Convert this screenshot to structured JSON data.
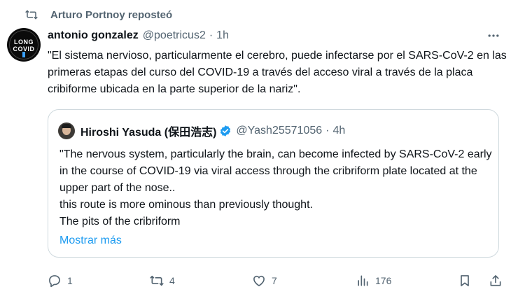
{
  "repost": {
    "text": "Arturo Portnoy reposteó"
  },
  "tweet": {
    "author_name": "antonio gonzalez",
    "author_handle": "@poetricus2",
    "separator": "·",
    "time": "1h",
    "avatar_text_top": "LONG",
    "avatar_text_bottom": "COVID",
    "text": "\"El sistema nervioso, particularmente el cerebro, puede infectarse por el SARS-CoV-2 en las primeras etapas del curso del COVID-19 a través del acceso viral a través de la placa cribiforme ubicada en la parte superior de la nariz\"."
  },
  "quote": {
    "author_name": "Hiroshi Yasuda (保田浩志)",
    "author_handle": "@Yash25571056",
    "separator": "·",
    "time": "4h",
    "text": "\"The nervous system, particularly the brain, can become infected by SARS-CoV-2 early in the course of COVID-19 via viral access through the cribriform plate located at the upper part of the nose..\nthis route is more ominous than previously thought.\nThe pits of the cribriform",
    "show_more": "Mostrar más"
  },
  "actions": {
    "replies": "1",
    "reposts": "4",
    "likes": "7",
    "views": "176"
  },
  "icons": {
    "repost": "repost-icon",
    "more": "more-icon",
    "verified": "verified-badge-icon",
    "reply": "reply-icon",
    "like": "heart-icon",
    "views": "views-icon",
    "bookmark": "bookmark-icon",
    "share": "share-icon"
  },
  "colors": {
    "secondary_text": "#536471",
    "link": "#1d9bf0",
    "border": "#cfd9de",
    "verified": "#1d9bf0"
  }
}
